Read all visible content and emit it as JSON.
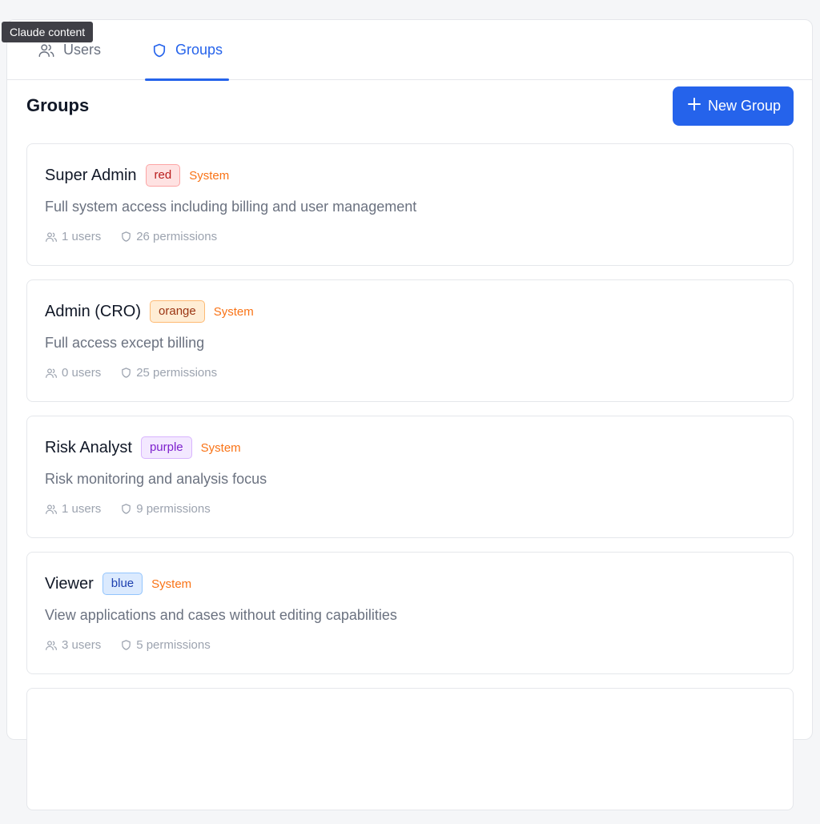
{
  "tooltip": "Claude content",
  "tabs": [
    {
      "label": "Users",
      "icon": "users-icon",
      "active": false
    },
    {
      "label": "Groups",
      "icon": "shield-icon",
      "active": true
    }
  ],
  "page_title": "Groups",
  "new_group_button": {
    "icon": "plus-icon",
    "label": "New Group"
  },
  "colors": {
    "accent": "#2563eb",
    "system": "#f97316",
    "muted": "#6b7280"
  },
  "groups": [
    {
      "name": "Super Admin",
      "color_tag": "red",
      "system": "System",
      "description": "Full system access including billing and user management",
      "users": "1 users",
      "permissions": "26 permissions"
    },
    {
      "name": "Admin (CRO)",
      "color_tag": "orange",
      "system": "System",
      "description": "Full access except billing",
      "users": "0 users",
      "permissions": "25 permissions"
    },
    {
      "name": "Risk Analyst",
      "color_tag": "purple",
      "system": "System",
      "description": "Risk monitoring and analysis focus",
      "users": "1 users",
      "permissions": "9 permissions"
    },
    {
      "name": "Viewer",
      "color_tag": "blue",
      "system": "System",
      "description": "View applications and cases without editing capabilities",
      "users": "3 users",
      "permissions": "5 permissions"
    }
  ]
}
